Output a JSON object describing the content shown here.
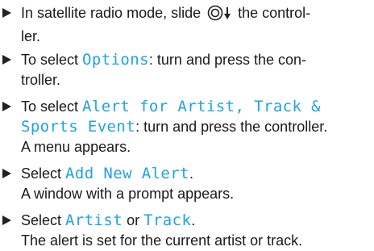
{
  "steps": [
    {
      "line1_before_icon": "In satellite radio mode, slide ",
      "line1_after_icon": " the control-",
      "line2": "ler.",
      "icon": "controller-slide-down-icon"
    },
    {
      "line1": "To select ",
      "line1_display": "Options",
      "line1_after": ": turn and press the con-",
      "line2": "troller."
    },
    {
      "line1": "To select ",
      "line1_display": "Alert for Artist, Track &",
      "line2_display": "Sports Event",
      "line2_after": ": turn and press the controller.",
      "result": "A menu appears."
    },
    {
      "line1": "Select ",
      "line1_display": "Add New Alert",
      "line1_after": ".",
      "result": "A window with a prompt appears."
    },
    {
      "line1": "Select ",
      "display_a": "Artist",
      "connector": " or ",
      "display_b": "Track",
      "line1_after": ".",
      "result": "The alert is set for the current artist or track."
    }
  ],
  "colors": {
    "display_text": "#1fa3e4",
    "body_text": "#1a1a1a",
    "bullet": "#222222"
  }
}
